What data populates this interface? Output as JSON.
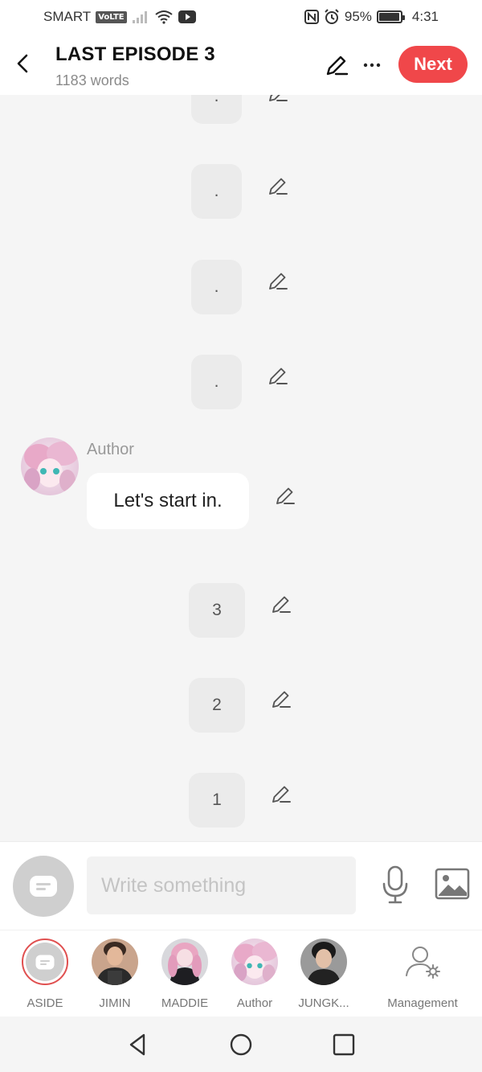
{
  "status_bar": {
    "carrier": "SMART",
    "volte": "VoLTE",
    "battery_text": "95%",
    "battery_level": 0.95,
    "time": "4:31"
  },
  "header": {
    "title": "LAST EPISODE 3",
    "word_count": "1183 words",
    "next_label": "Next"
  },
  "messages": {
    "aside_1": ".",
    "aside_2": ".",
    "aside_3": ".",
    "aside_4": ".",
    "author_name": "Author",
    "author_text": "Let's start in.",
    "count_3": "3",
    "count_2": "2",
    "count_1": "1"
  },
  "input": {
    "placeholder": "Write something"
  },
  "characters": [
    {
      "name": "ASIDE"
    },
    {
      "name": "JIMIN"
    },
    {
      "name": "MADDIE"
    },
    {
      "name": "Author"
    },
    {
      "name": "JUNGK..."
    }
  ],
  "management_label": "Management",
  "colors": {
    "accent": "#f0474a",
    "bubble_gray": "#ebebeb",
    "background": "#f5f5f5"
  },
  "icons": {
    "back": "chevron-left-icon",
    "edit": "pencil-icon",
    "more": "more-dots-icon",
    "mic": "microphone-icon",
    "image": "image-icon",
    "aside": "aside-chat-icon",
    "management": "user-gear-icon",
    "nav_back": "triangle-back-icon",
    "nav_home": "circle-home-icon",
    "nav_recents": "square-recents-icon"
  }
}
